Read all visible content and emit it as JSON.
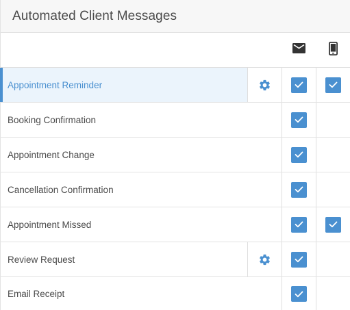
{
  "header": {
    "title": "Automated Client Messages"
  },
  "columns": [
    {
      "icon": "email-icon"
    },
    {
      "icon": "mobile-phone-icon"
    }
  ],
  "rows": [
    {
      "label": "Appointment Reminder",
      "active": true,
      "settings": true,
      "email": true,
      "sms": true
    },
    {
      "label": "Booking Confirmation",
      "active": false,
      "settings": false,
      "email": true,
      "sms": false
    },
    {
      "label": "Appointment Change",
      "active": false,
      "settings": false,
      "email": true,
      "sms": false
    },
    {
      "label": "Cancellation Confirmation",
      "active": false,
      "settings": false,
      "email": true,
      "sms": false
    },
    {
      "label": "Appointment Missed",
      "active": false,
      "settings": false,
      "email": true,
      "sms": true
    },
    {
      "label": "Review Request",
      "active": false,
      "settings": true,
      "email": true,
      "sms": false
    },
    {
      "label": "Email Receipt",
      "active": false,
      "settings": false,
      "email": true,
      "sms": false
    }
  ],
  "colors": {
    "accent": "#4a90d0",
    "active_row_bg": "#ebf4fc",
    "header_bg": "#f7f7f7"
  }
}
